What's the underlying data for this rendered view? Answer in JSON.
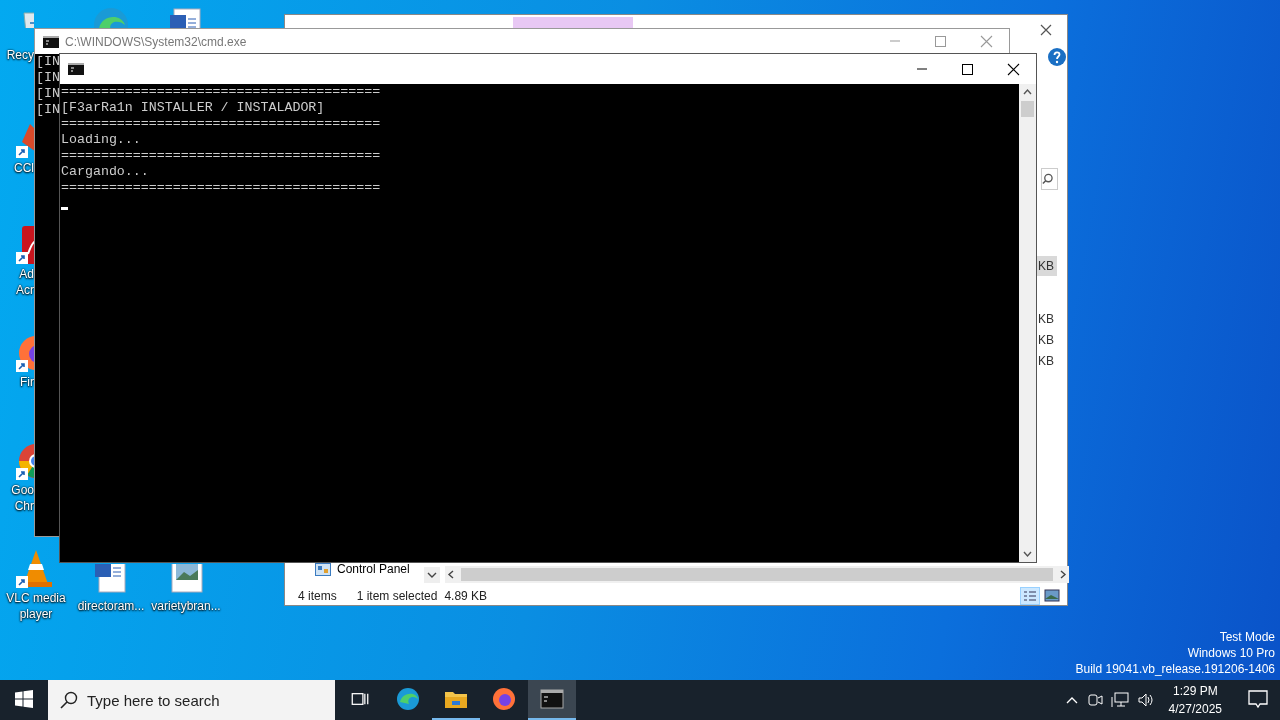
{
  "desktop_icons": [
    {
      "kind": "bin",
      "label": "Recy",
      "obscured": true,
      "shortcut": false
    },
    {
      "kind": "brush",
      "label": "CCl",
      "obscured": true,
      "shortcut": true
    },
    {
      "kind": "pdf",
      "label": "Ad\nAcr",
      "obscured": true,
      "shortcut": true
    },
    {
      "kind": "fox",
      "label": "Fir",
      "obscured": true,
      "shortcut": true
    },
    {
      "kind": "chrome",
      "label": "Goo\nChr",
      "obscured": true,
      "shortcut": true
    },
    {
      "kind": "cone",
      "label": "VLC media\nplayer",
      "obscured": false,
      "shortcut": true
    },
    {
      "kind": "edge",
      "obscured": true,
      "shortcut": false
    },
    {
      "kind": "doc",
      "label": "directoram...",
      "obscured": false,
      "shortcut": false
    },
    {
      "kind": "doc",
      "obscured": true,
      "shortcut": false
    },
    {
      "kind": "image",
      "label": "varietybran...",
      "obscured": false,
      "shortcut": false
    }
  ],
  "explorer_window": {
    "file_groups": [
      {
        "rows": [
          {
            "size": "KB",
            "selected": true
          }
        ]
      },
      {
        "rows": [
          {
            "size": "KB",
            "selected": false
          },
          {
            "size": "KB",
            "selected": false
          },
          {
            "size": "KB",
            "selected": false
          }
        ]
      }
    ],
    "nav_item": "Control Panel",
    "status_bar": {
      "count": "4 items",
      "selection": "1 item selected",
      "size": "4.89 KB"
    }
  },
  "back_console": {
    "title": "C:\\WINDOWS\\System32\\cmd.exe",
    "lines": [
      "[IN",
      "[IN",
      "[IN",
      "[IN"
    ]
  },
  "console": {
    "lines": [
      "========================================",
      "[F3arRa1n INSTALLER / INSTALADOR]",
      "========================================",
      "Loading...",
      "========================================",
      "Cargando...",
      "========================================"
    ]
  },
  "system_notice": [
    "Test Mode",
    "Windows 10 Pro",
    "Build 19041.vb_release.191206-1406"
  ],
  "taskbar": {
    "search": {
      "placeholder": "Type here to search"
    },
    "apps": [
      {
        "kind": "taskview",
        "running": false,
        "selected": false
      },
      {
        "kind": "edge",
        "running": false,
        "selected": false
      },
      {
        "kind": "folder",
        "running": true,
        "selected": false
      },
      {
        "kind": "fox",
        "running": false,
        "selected": false
      },
      {
        "kind": "console",
        "running": true,
        "selected": true
      }
    ],
    "clock": {
      "time": "1:29 PM",
      "date": "4/27/2025"
    }
  }
}
